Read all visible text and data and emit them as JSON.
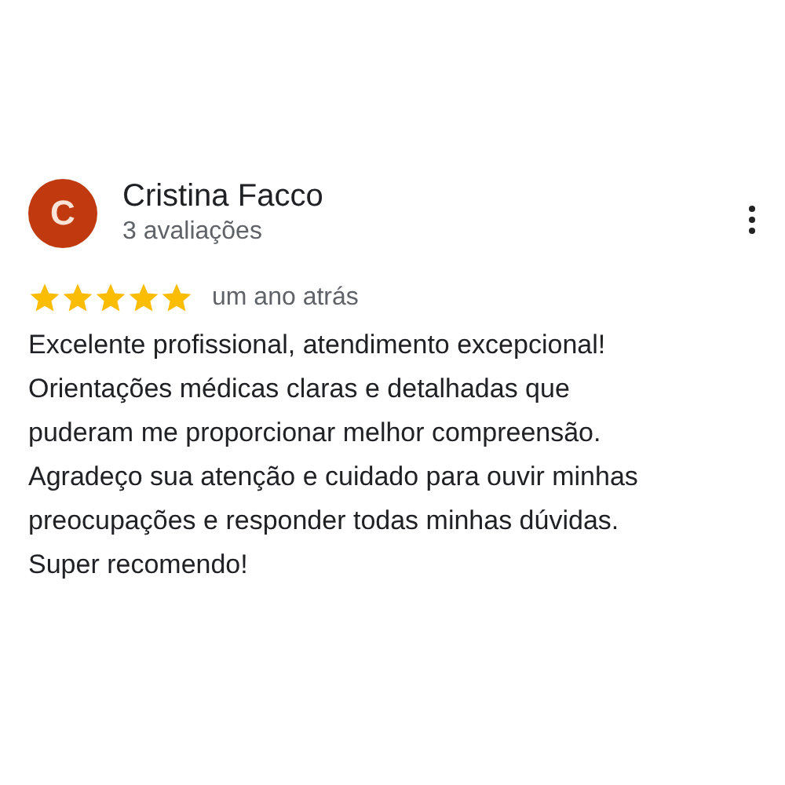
{
  "review": {
    "avatar_letter": "C",
    "author": "Cristina Facco",
    "reviews_count": "3 avaliações",
    "stars": 5,
    "time": "um ano atrás",
    "text": "Excelente profissional, atendimento excepcional!\nOrientações médicas claras e detalhadas que\npuderam me proporcionar melhor compreensão.\nAgradeço sua atenção e cuidado para ouvir minhas\npreocupações e responder todas minhas dúvidas.\nSuper recomendo!"
  }
}
